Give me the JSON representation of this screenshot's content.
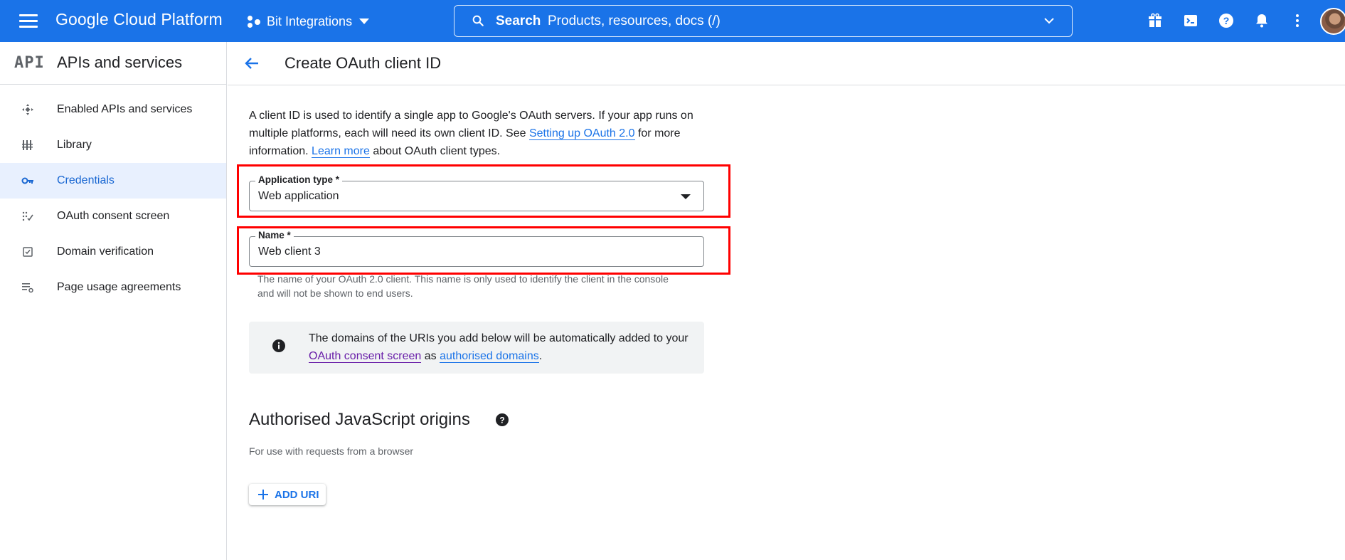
{
  "topbar": {
    "brand": "Google Cloud Platform",
    "project": "Bit Integrations",
    "search_label": "Search",
    "search_placeholder": "Products, resources, docs (/)"
  },
  "sidebar": {
    "title": "APIs and services",
    "logo_text": "API",
    "items": [
      {
        "label": "Enabled APIs and services",
        "icon": "api-hub-icon"
      },
      {
        "label": "Library",
        "icon": "library-icon"
      },
      {
        "label": "Credentials",
        "icon": "key-icon",
        "active": true
      },
      {
        "label": "OAuth consent screen",
        "icon": "consent-icon"
      },
      {
        "label": "Domain verification",
        "icon": "checkbox-icon"
      },
      {
        "label": "Page usage agreements",
        "icon": "settings-list-icon"
      }
    ]
  },
  "page": {
    "title": "Create OAuth client ID"
  },
  "intro": {
    "text1": "A client ID is used to identify a single app to Google's OAuth servers. If your app runs on multiple platforms, each will need its own client ID. See ",
    "link1": "Setting up OAuth 2.0",
    "text2": " for more information. ",
    "link2": "Learn more",
    "text3": " about OAuth client types."
  },
  "form": {
    "app_type_label": "Application type *",
    "app_type_value": "Web application",
    "name_label": "Name *",
    "name_value": "Web client 3",
    "name_hint": "The name of your OAuth 2.0 client. This name is only used to identify the client in the console and will not be shown to end users."
  },
  "info_box": {
    "text1": "The domains of the URIs you add below will be automatically added to your ",
    "link1": "OAuth consent screen",
    "text2": " as ",
    "link2": "authorised domains",
    "text3": "."
  },
  "js_origins": {
    "title": "Authorised JavaScript origins",
    "subtitle": "For use with requests from a browser",
    "add_button": "ADD URI"
  },
  "colors": {
    "topbar": "#1a73e8",
    "highlight": "#ff0000",
    "active_bg": "#e8f0fe",
    "link": "#1a73e8"
  }
}
